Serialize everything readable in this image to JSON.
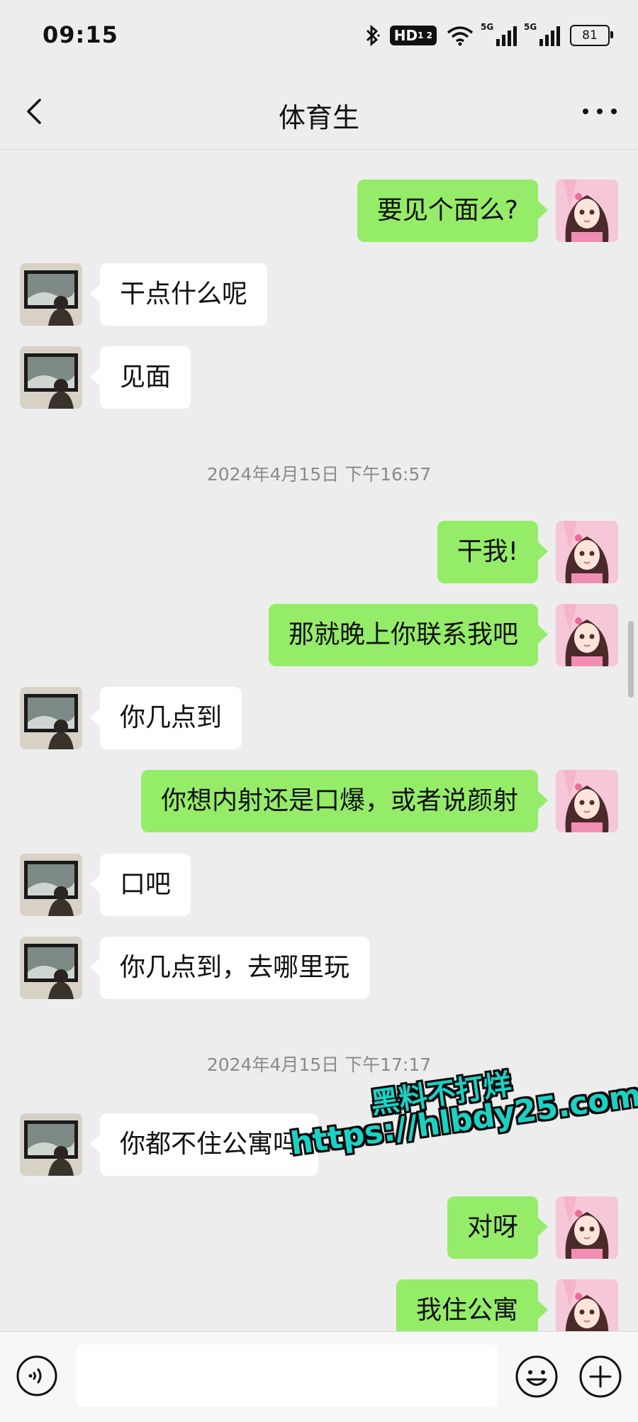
{
  "status_bar": {
    "time": "09:15",
    "hd_label": "HD",
    "hd_sub": "1 2",
    "network_1": "5G",
    "network_2": "5G",
    "battery": "81"
  },
  "nav": {
    "title": "体育生",
    "back_icon": "chevron-left-icon",
    "more_icon": "more-dots-icon"
  },
  "messages": [
    {
      "side": "right",
      "text": "要见个面么?"
    },
    {
      "side": "left",
      "text": "干点什么呢"
    },
    {
      "side": "left",
      "text": "见面"
    },
    {
      "timestamp": "2024年4月15日 下午16:57"
    },
    {
      "side": "right",
      "text": "干我!"
    },
    {
      "side": "right",
      "text": "那就晚上你联系我吧"
    },
    {
      "side": "left",
      "text": "你几点到"
    },
    {
      "side": "right",
      "text": "你想内射还是口爆，或者说颜射"
    },
    {
      "side": "left",
      "text": "口吧"
    },
    {
      "side": "left",
      "text": "你几点到，去哪里玩"
    },
    {
      "timestamp": "2024年4月15日 下午17:17"
    },
    {
      "side": "left",
      "text": "你都不住公寓吗"
    },
    {
      "side": "right",
      "text": "对呀"
    },
    {
      "side": "right",
      "text": "我住公寓"
    }
  ],
  "watermark": {
    "line1": "黑料不打烊",
    "line2": "https://hlbdy25.com"
  },
  "input_bar": {
    "voice_icon": "voice-icon",
    "emoji_icon": "emoji-icon",
    "plus_icon": "plus-icon",
    "input_value": ""
  },
  "colors": {
    "background": "#ededed",
    "bubble_self": "#95ec69",
    "bubble_other": "#ffffff",
    "timestamp_text": "#8a8a8a",
    "watermark": "#1bd1c4"
  }
}
